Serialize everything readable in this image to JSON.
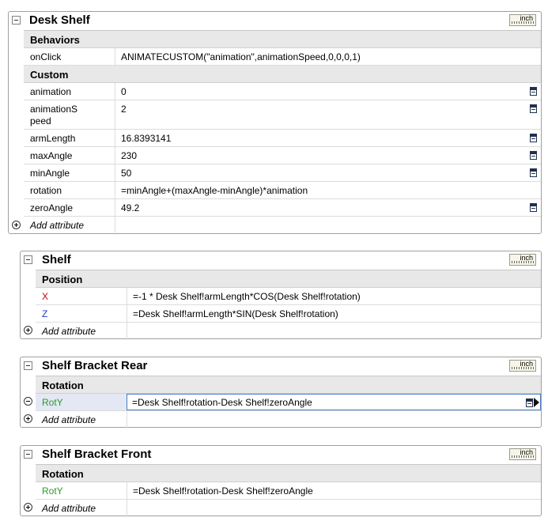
{
  "colors": {
    "x_axis": "#cc0000",
    "z_axis": "#1a3cc8",
    "y_axis": "#2a9a2a",
    "section_bg": "#e8e8e8"
  },
  "units_label": "inch",
  "add_attribute_label": "Add attribute",
  "panels": {
    "desk_shelf": {
      "title": "Desk Shelf",
      "sections": {
        "behaviors": "Behaviors",
        "custom": "Custom"
      },
      "rows": {
        "onclick": {
          "name": "onClick",
          "value": "ANIMATECUSTOM(\"animation\",animationSpeed,0,0,0,1)"
        },
        "animation": {
          "name": "animation",
          "value": "0"
        },
        "animation_speed": {
          "name_line1": "animationS",
          "name_line2": "peed",
          "value": "2"
        },
        "arm_length": {
          "name": "armLength",
          "value": "16.8393141"
        },
        "max_angle": {
          "name": "maxAngle",
          "value": "230"
        },
        "min_angle": {
          "name": "minAngle",
          "value": "50"
        },
        "rotation": {
          "name": "rotation",
          "value": "=minAngle+(maxAngle-minAngle)*animation"
        },
        "zero_angle": {
          "name": "zeroAngle",
          "value": "49.2"
        }
      }
    },
    "shelf": {
      "title": "Shelf",
      "section": "Position",
      "rows": {
        "x": {
          "name": "X",
          "value": "=-1 * Desk Shelf!armLength*COS(Desk Shelf!rotation)"
        },
        "z": {
          "name": "Z",
          "value": "=Desk Shelf!armLength*SIN(Desk Shelf!rotation)"
        }
      }
    },
    "bracket_rear": {
      "title": "Shelf Bracket Rear",
      "section": "Rotation",
      "rows": {
        "roty": {
          "name": "RotY",
          "value": "=Desk Shelf!rotation-Desk Shelf!zeroAngle"
        }
      }
    },
    "bracket_front": {
      "title": "Shelf Bracket Front",
      "section": "Rotation",
      "rows": {
        "roty": {
          "name": "RotY",
          "value": "=Desk Shelf!rotation-Desk Shelf!zeroAngle"
        }
      }
    }
  }
}
